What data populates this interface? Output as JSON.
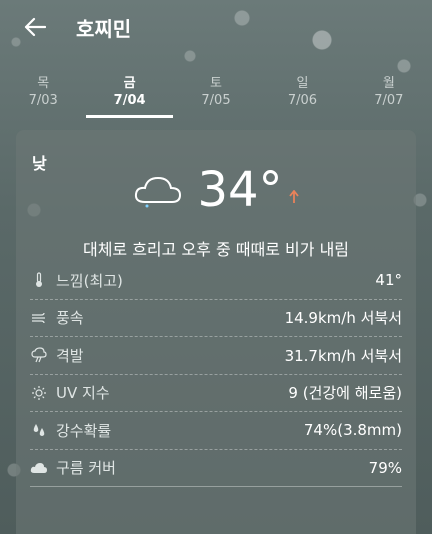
{
  "header": {
    "title": "호찌민"
  },
  "tabs": [
    {
      "day": "목",
      "date": "7/03"
    },
    {
      "day": "금",
      "date": "7/04"
    },
    {
      "day": "토",
      "date": "7/05"
    },
    {
      "day": "일",
      "date": "7/06"
    },
    {
      "day": "월",
      "date": "7/07"
    }
  ],
  "forecast": {
    "period": "낮",
    "temperature": "34°",
    "summary": "대체로 흐리고 오후 중 때때로 비가 내림"
  },
  "details": [
    {
      "label": "느낌(최고)",
      "value": "41°",
      "icon": "thermometer-icon"
    },
    {
      "label": "풍속",
      "value": "14.9km/h 서북서",
      "icon": "wind-icon"
    },
    {
      "label": "격발",
      "value": "31.7km/h 서북서",
      "icon": "gust-icon"
    },
    {
      "label": "UV 지수",
      "value": "9 (건강에 해로움)",
      "icon": "sun-icon"
    },
    {
      "label": "강수확률",
      "value": "74%(3.8mm)",
      "icon": "raindrops-icon"
    },
    {
      "label": "구름 커버",
      "value": "79%",
      "icon": "cloud-icon"
    }
  ],
  "colors": {
    "trend_arrow": "#e8825a",
    "active_tab_underline": "#ffffff"
  }
}
